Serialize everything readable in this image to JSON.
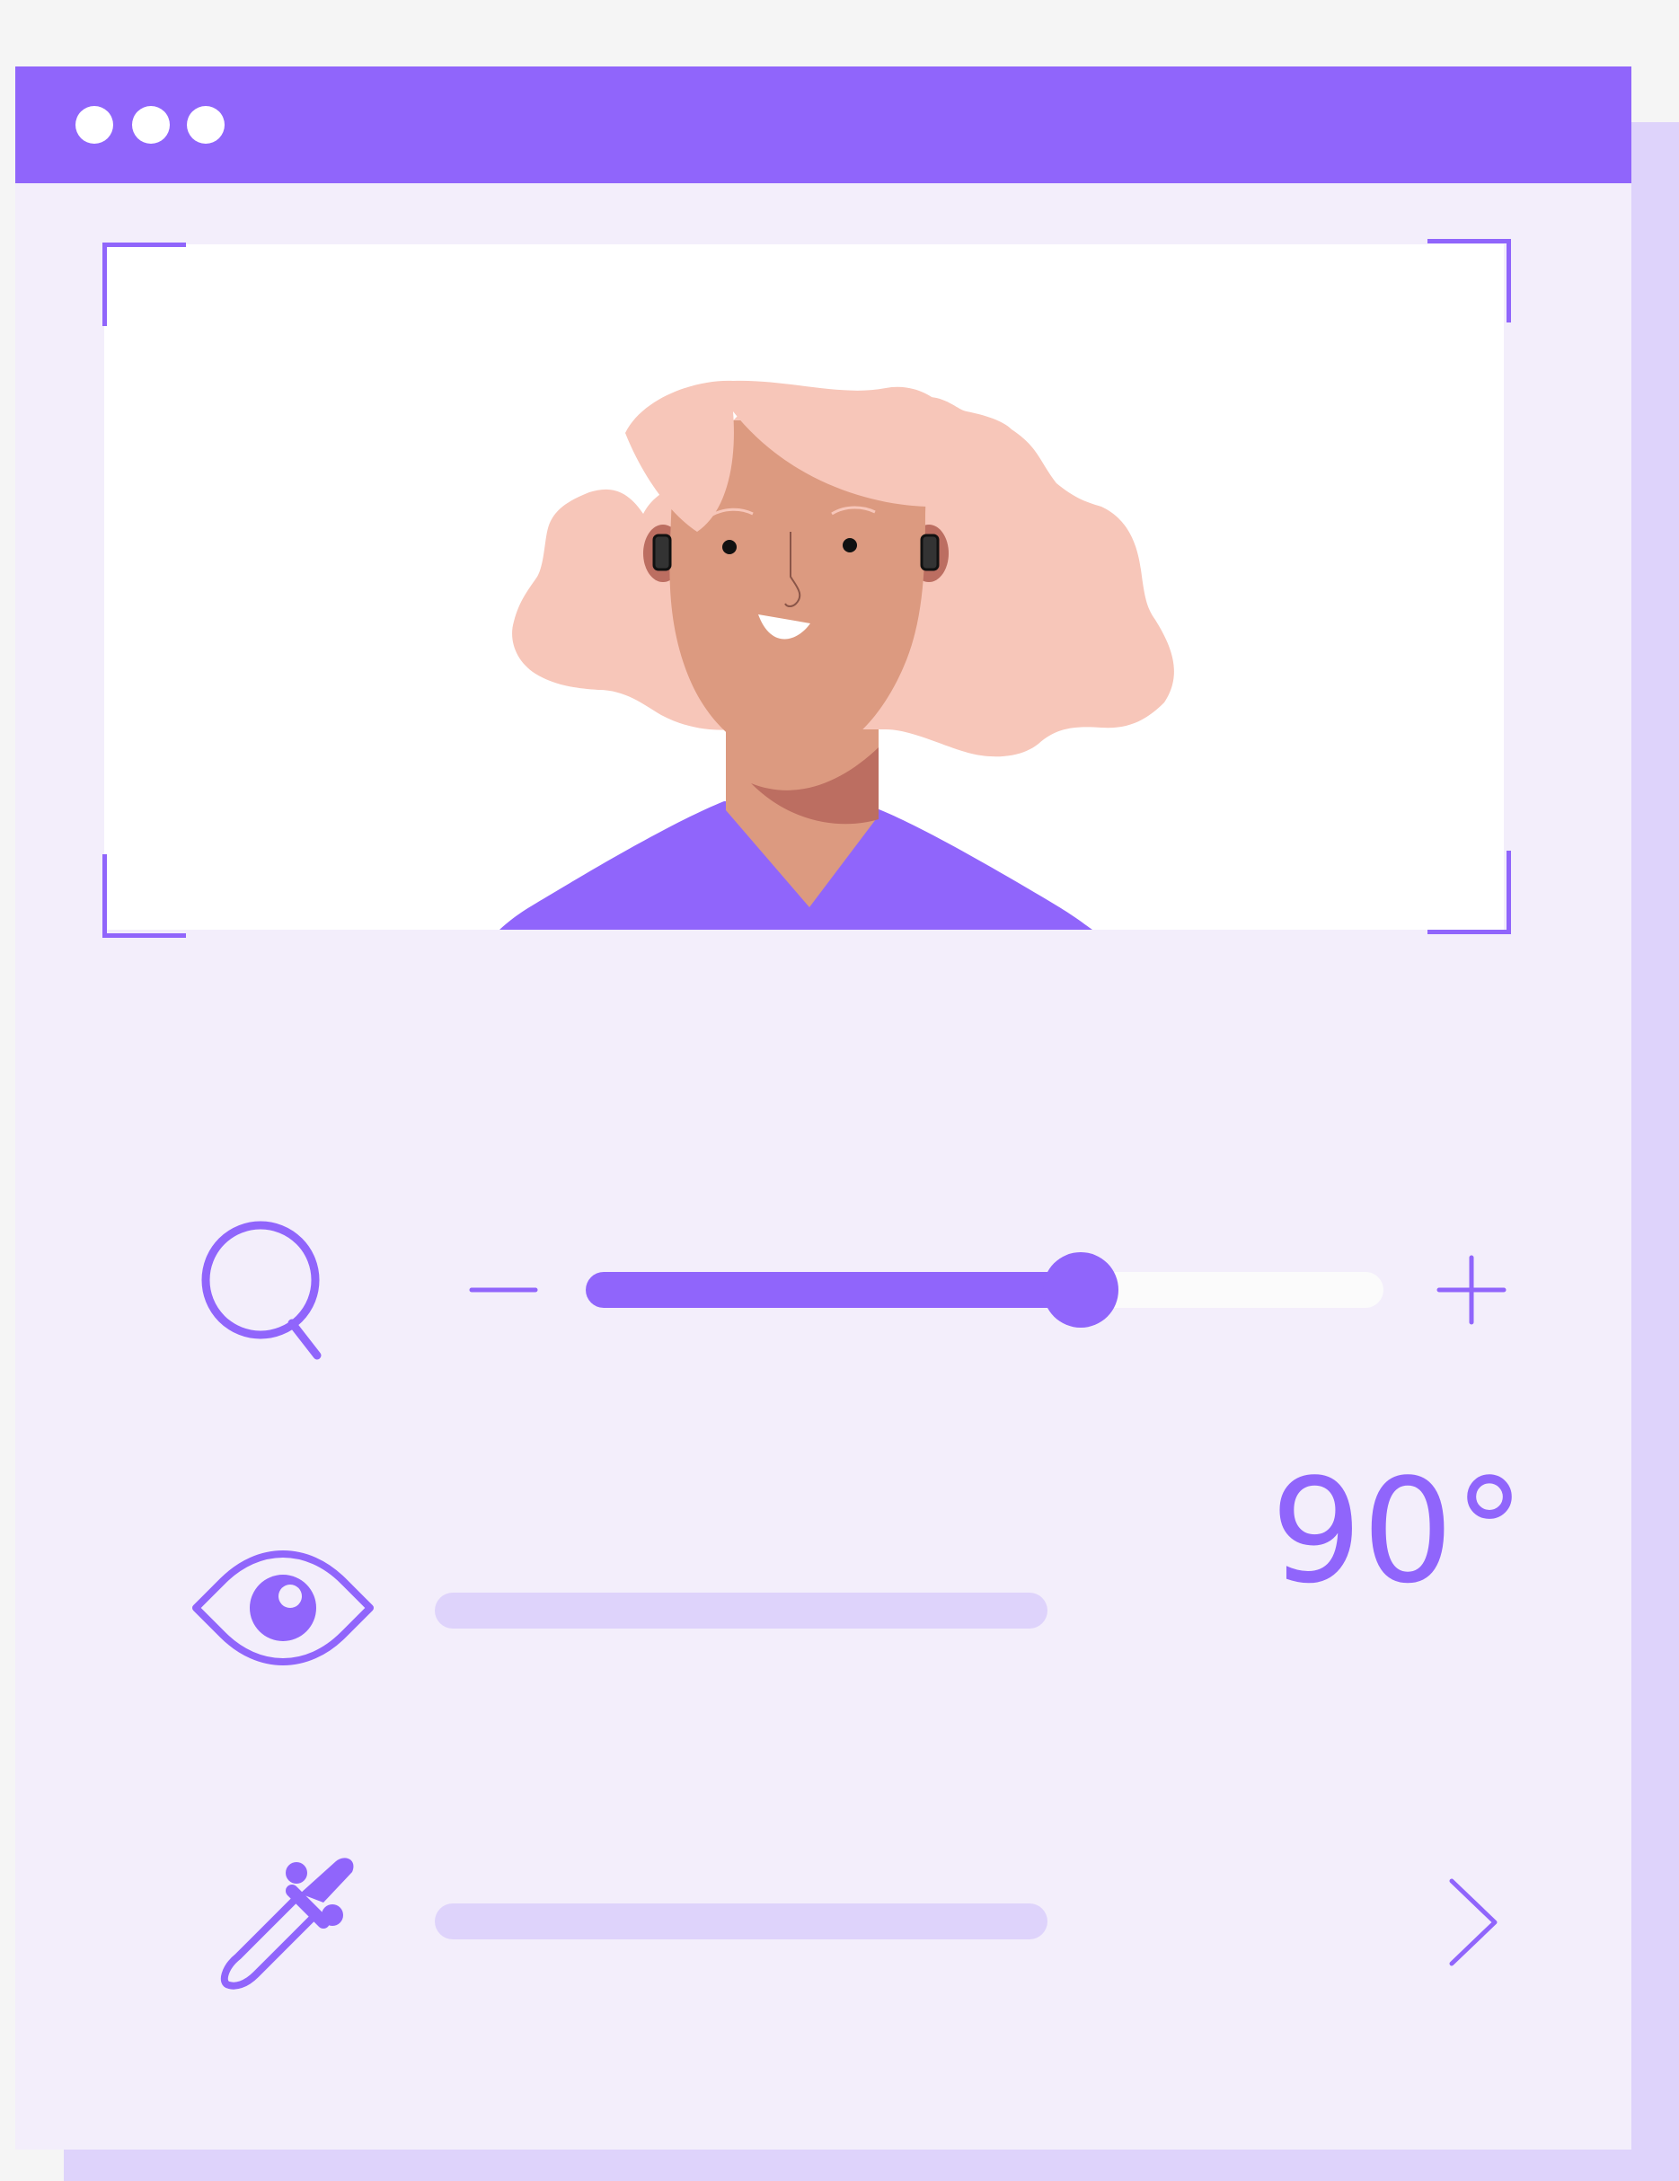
{
  "window": {
    "controls": [
      "dot",
      "dot",
      "dot"
    ]
  },
  "zoom": {
    "icon": "search-icon",
    "decrease_icon": "minus-icon",
    "increase_icon": "plus-icon",
    "level": 0.62
  },
  "view": {
    "icon": "eye-icon",
    "value": "90°"
  },
  "color": {
    "icon": "eyedropper-icon",
    "action_icon": "chevron-right-icon"
  },
  "colors": {
    "accent": "#9065fb",
    "panel": "#f3eefb",
    "track": "#ded3fb",
    "hair": "#f7c6b9",
    "skin": "#dc9a80"
  }
}
